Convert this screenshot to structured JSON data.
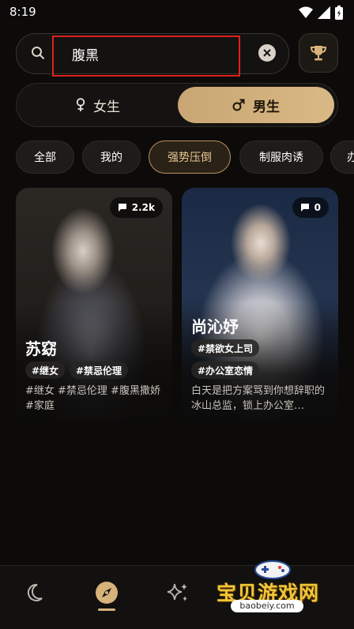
{
  "status_bar": {
    "time": "8:19"
  },
  "search": {
    "value": "腹黑"
  },
  "gender": {
    "female_label": "女生",
    "male_label": "男生",
    "selected": "男生"
  },
  "chips": [
    {
      "label": "全部"
    },
    {
      "label": "我的"
    },
    {
      "label": "强势压倒"
    },
    {
      "label": "制服肉诱"
    },
    {
      "label": "办"
    }
  ],
  "cards": [
    {
      "name": "苏窈",
      "count": "2.2k",
      "tags": [
        "#继女",
        "#禁忌伦理"
      ],
      "description": "#继女 #禁忌伦理 #腹黑撒娇 #家庭"
    },
    {
      "name": "尚沁妤",
      "count": "0",
      "tags": [
        "#禁欲女上司",
        "#办公室恋情"
      ],
      "description": "白天是把方案骂到你想辞职的冰山总监，锁上办公室…"
    }
  ],
  "watermark": {
    "title": "宝贝游戏网",
    "url": "baobeiy.com"
  },
  "colors": {
    "accent": "#d7b27a",
    "highlight_box": "#e0201e"
  }
}
